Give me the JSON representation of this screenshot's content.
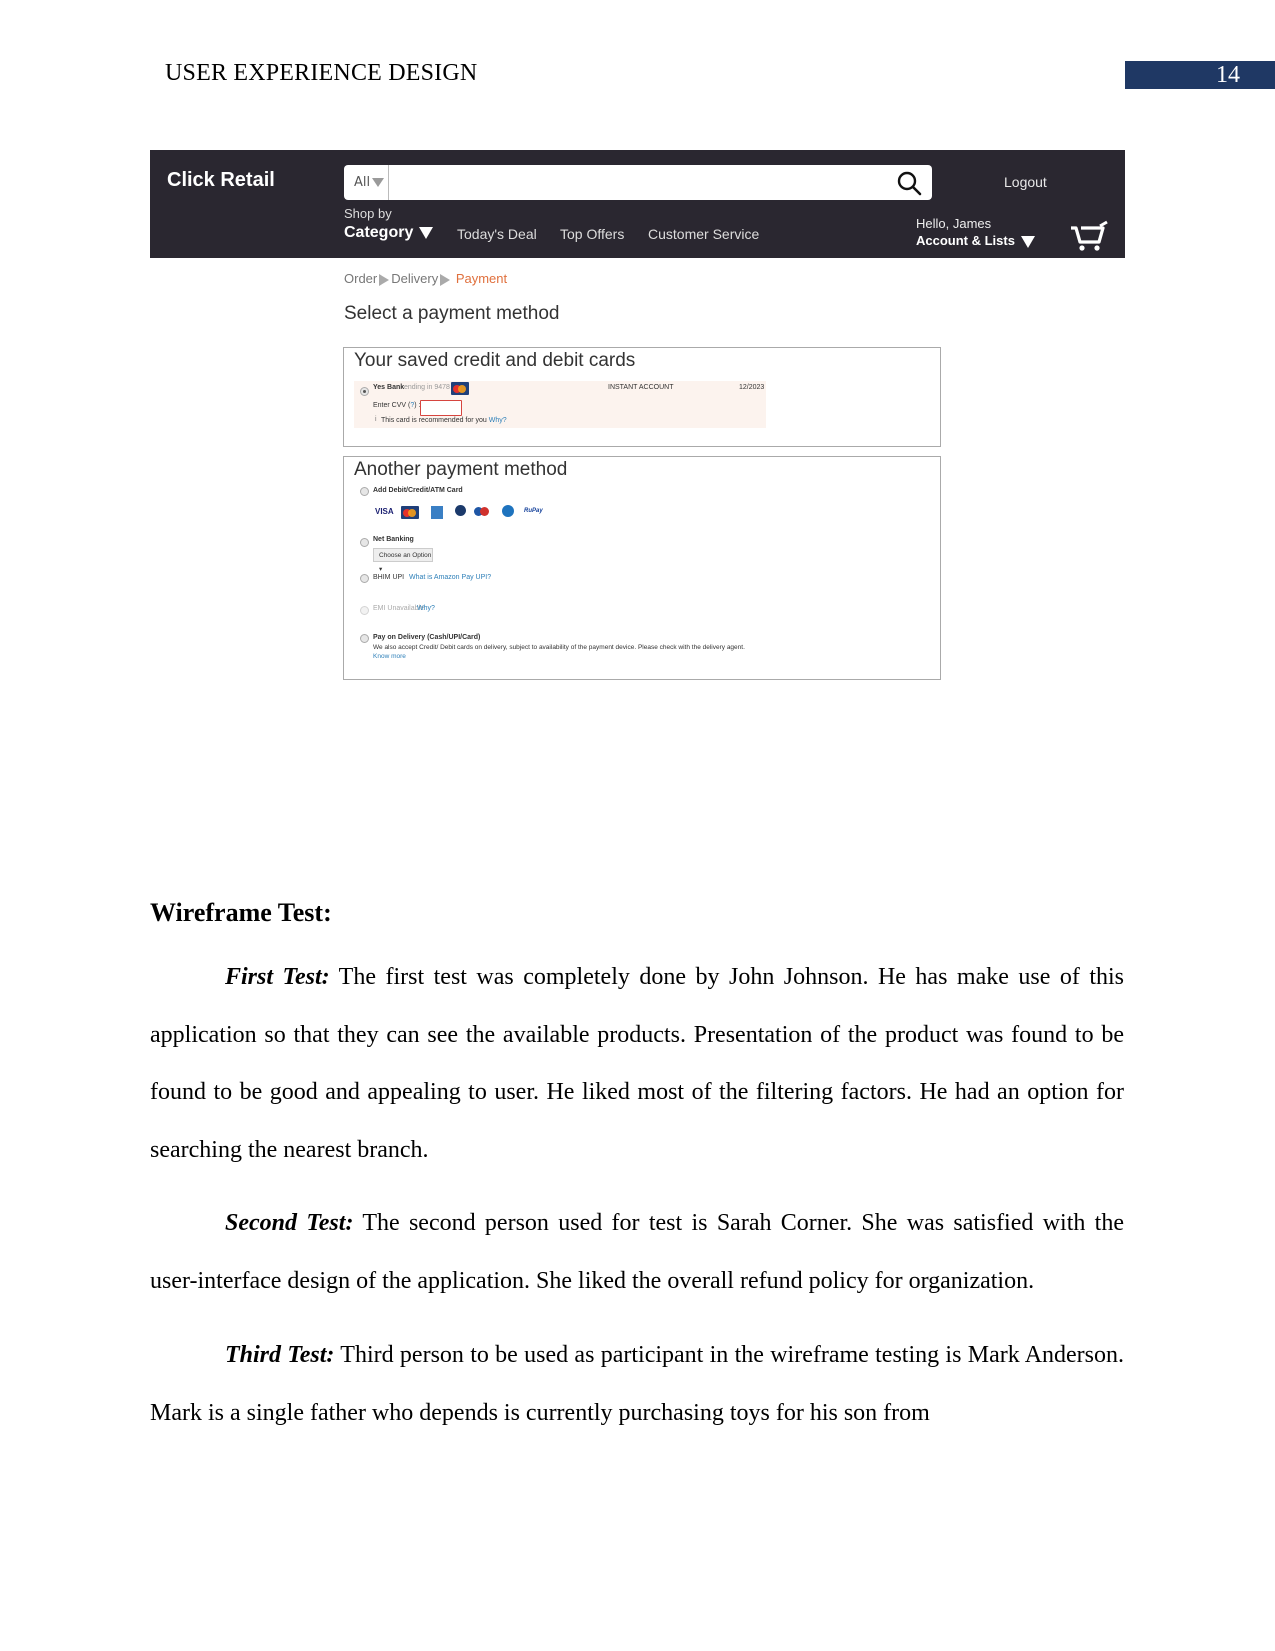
{
  "page": {
    "running_head": "USER EXPERIENCE DESIGN",
    "page_number": "14",
    "accent_color": "#1f3864"
  },
  "mockup": {
    "brand": "Click Retail",
    "search": {
      "category": "All",
      "value": "",
      "icon": "search-icon"
    },
    "logout": "Logout",
    "shop_by": "Shop by",
    "category": "Category",
    "nav_links": [
      "Today's Deal",
      "Top Offers",
      "Customer Service"
    ],
    "greeting": "Hello, James",
    "account": "Account & Lists",
    "cart_icon": "cart-icon",
    "breadcrumb": [
      "Order",
      "Delivery",
      "Payment"
    ],
    "breadcrumb_active_color": "#e0703d",
    "title": "Select a payment method",
    "saved_cards": {
      "heading": "Your saved credit and debit cards",
      "bank": "Yes Bank",
      "ending": "ending in 9478",
      "account_type": "INSTANT ACCOUNT",
      "expiry": "12/2023",
      "cvv_label": "Enter CVV (",
      "cvv_help": "?",
      "cvv_suffix": ") :",
      "info_icon": "i",
      "recommend": "This card is recommended for you",
      "why": "Why?"
    },
    "other_methods": {
      "heading": "Another payment method",
      "card_option": "Add Debit/Credit/ATM Card",
      "card_logos": [
        "VISA",
        "MasterCard",
        "American Express",
        "Diners Club",
        "Maestro",
        "Bajaj",
        "RuPay"
      ],
      "net_banking": "Net Banking",
      "net_banking_select": "Choose an Option",
      "upi": "BHIM UPI",
      "upi_link": "What is Amazon Pay UPI?",
      "emi": "EMI Unavailable",
      "emi_link": "Why?",
      "pod": "Pay on Delivery (Cash/UPI/Card)",
      "pod_desc": "We also accept Credit/ Debit cards on delivery, subject to availability of the payment device. Please check with the delivery agent.",
      "pod_link": "Know more"
    }
  },
  "body": {
    "heading": "Wireframe Test:",
    "tests": [
      {
        "lead": "First Test:",
        "text": " The first test was completely done by John Johnson. He has make use of this application so that they can see the available products. Presentation of the product was found to be found to be good and appealing to user. He liked most of the filtering factors. He had an option for searching the nearest branch."
      },
      {
        "lead": "Second Test:",
        "text": " The second person used for test is Sarah Corner. She was satisfied with the user-interface design of the application. She liked the overall refund policy for organization."
      },
      {
        "lead": "Third Test:",
        "text": " Third person to be used as participant in the wireframe testing is Mark Anderson. Mark is a single father who depends is currently purchasing toys for his son from"
      }
    ]
  }
}
